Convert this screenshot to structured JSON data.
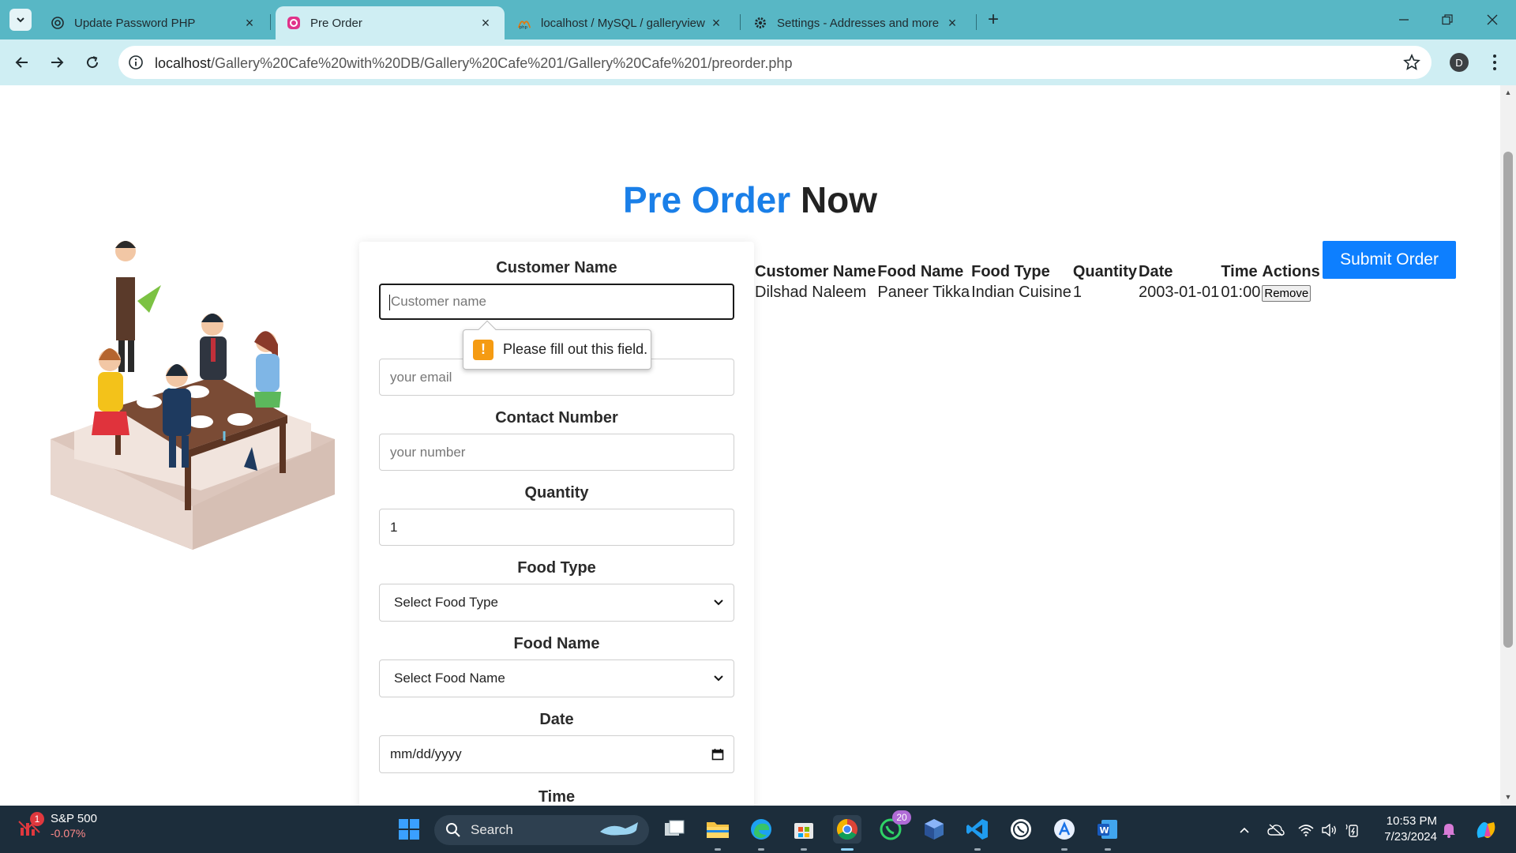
{
  "browser": {
    "tabs": [
      {
        "title": "Update Password PHP",
        "icon": "openai-icon",
        "active": false
      },
      {
        "title": "Pre Order",
        "icon": "app-icon",
        "active": true
      },
      {
        "title": "localhost / MySQL / galleryview",
        "icon": "phpmyadmin-icon",
        "active": false
      },
      {
        "title": "Settings - Addresses and more",
        "icon": "gear-icon",
        "active": false
      }
    ],
    "url_host": "localhost",
    "url_path": "/Gallery%20Cafe%20with%20DB/Gallery%20Cafe%201/Gallery%20Cafe%201/preorder.php",
    "profile_initial": "D"
  },
  "page": {
    "title_accent": "Pre Order",
    "title_rest": "Now",
    "colors": {
      "accent": "#1a7fe8",
      "submit": "#0d7fff",
      "tabstrip": "#58b7c5",
      "toolbar": "#cfeef3"
    }
  },
  "form": {
    "customer_name_label": "Customer Name",
    "customer_name_placeholder": "Customer name",
    "email_placeholder": "your email",
    "contact_label": "Contact Number",
    "contact_placeholder": "your number",
    "quantity_label": "Quantity",
    "quantity_value": "1",
    "food_type_label": "Food Type",
    "food_type_selected": "Select Food Type",
    "food_name_label": "Food Name",
    "food_name_selected": "Select Food Name",
    "date_label": "Date",
    "date_placeholder": "mm/dd/yyyy",
    "time_label": "Time",
    "validation_message": "Please fill out this field."
  },
  "order_table": {
    "headers": [
      "Customer Name",
      "Food Name",
      "Food Type",
      "Quantity",
      "Date",
      "Time",
      "Actions"
    ],
    "rows": [
      {
        "customer_name": "Dilshad Naleem",
        "food_name": "Paneer Tikka",
        "food_type": "Indian Cuisine",
        "quantity": "1",
        "date": "2003-01-01",
        "time": "01:00",
        "action": "Remove"
      }
    ],
    "submit_label": "Submit Order"
  },
  "taskbar": {
    "widget_title": "S&P 500",
    "widget_change": "-0.07%",
    "widget_badge": "1",
    "search_label": "Search",
    "whatsapp_badge": "20",
    "time": "10:53 PM",
    "date": "7/23/2024"
  }
}
